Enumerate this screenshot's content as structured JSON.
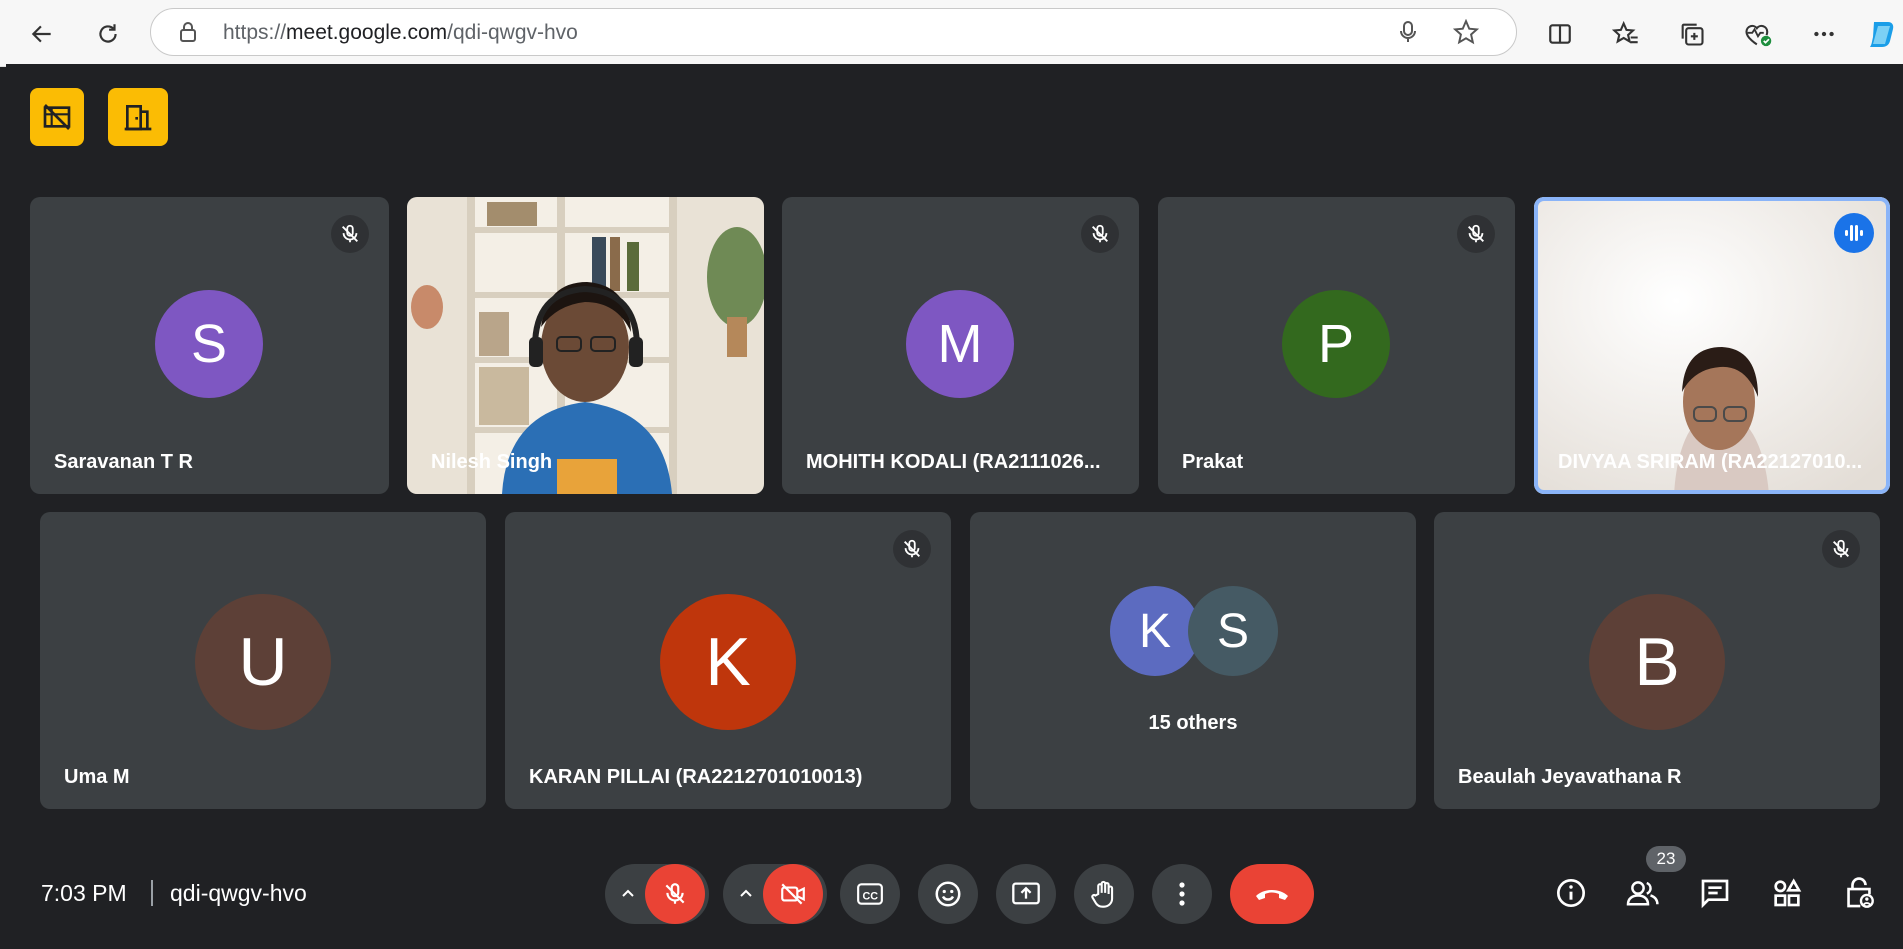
{
  "browser": {
    "url_prefix": "https://",
    "url_host": "meet.google.com",
    "url_path": "/qdi-qwgv-hvo"
  },
  "tiles_row1": [
    {
      "name": "Saravanan T R",
      "initial": "S",
      "avatar_color": "#7e57c2",
      "muted": true
    },
    {
      "name": "Nilesh Singh",
      "video": true
    },
    {
      "name": "MOHITH KODALI (RA2111026...",
      "initial": "M",
      "avatar_color": "#7e57c2",
      "muted": true
    },
    {
      "name": "Prakat",
      "initial": "P",
      "avatar_color": "#33691e",
      "muted": true
    },
    {
      "name": "DIVYAA SRIRAM (RA22127010...",
      "video": true,
      "speaking": true
    }
  ],
  "tiles_row2": [
    {
      "name": "Uma M",
      "initial": "U",
      "avatar_color": "#5d4037"
    },
    {
      "name": "KARAN PILLAI (RA2212701010013)",
      "initial": "K",
      "avatar_color": "#bf360c",
      "muted": true
    },
    {
      "others_label": "15 others",
      "initials": [
        "K",
        "S"
      ],
      "colors": [
        "#5c6bc0",
        "#455a64"
      ]
    },
    {
      "name": "Beaulah Jeyavathana R",
      "initial": "B",
      "avatar_color": "#5d4037",
      "muted": true
    }
  ],
  "bottom": {
    "time": "7:03 PM",
    "meeting_code": "qdi-qwgv-hvo",
    "participants_count": "23"
  },
  "colors": {
    "accent": "#8ab4f8",
    "danger": "#ea4335",
    "badge": "#fbbc04"
  }
}
